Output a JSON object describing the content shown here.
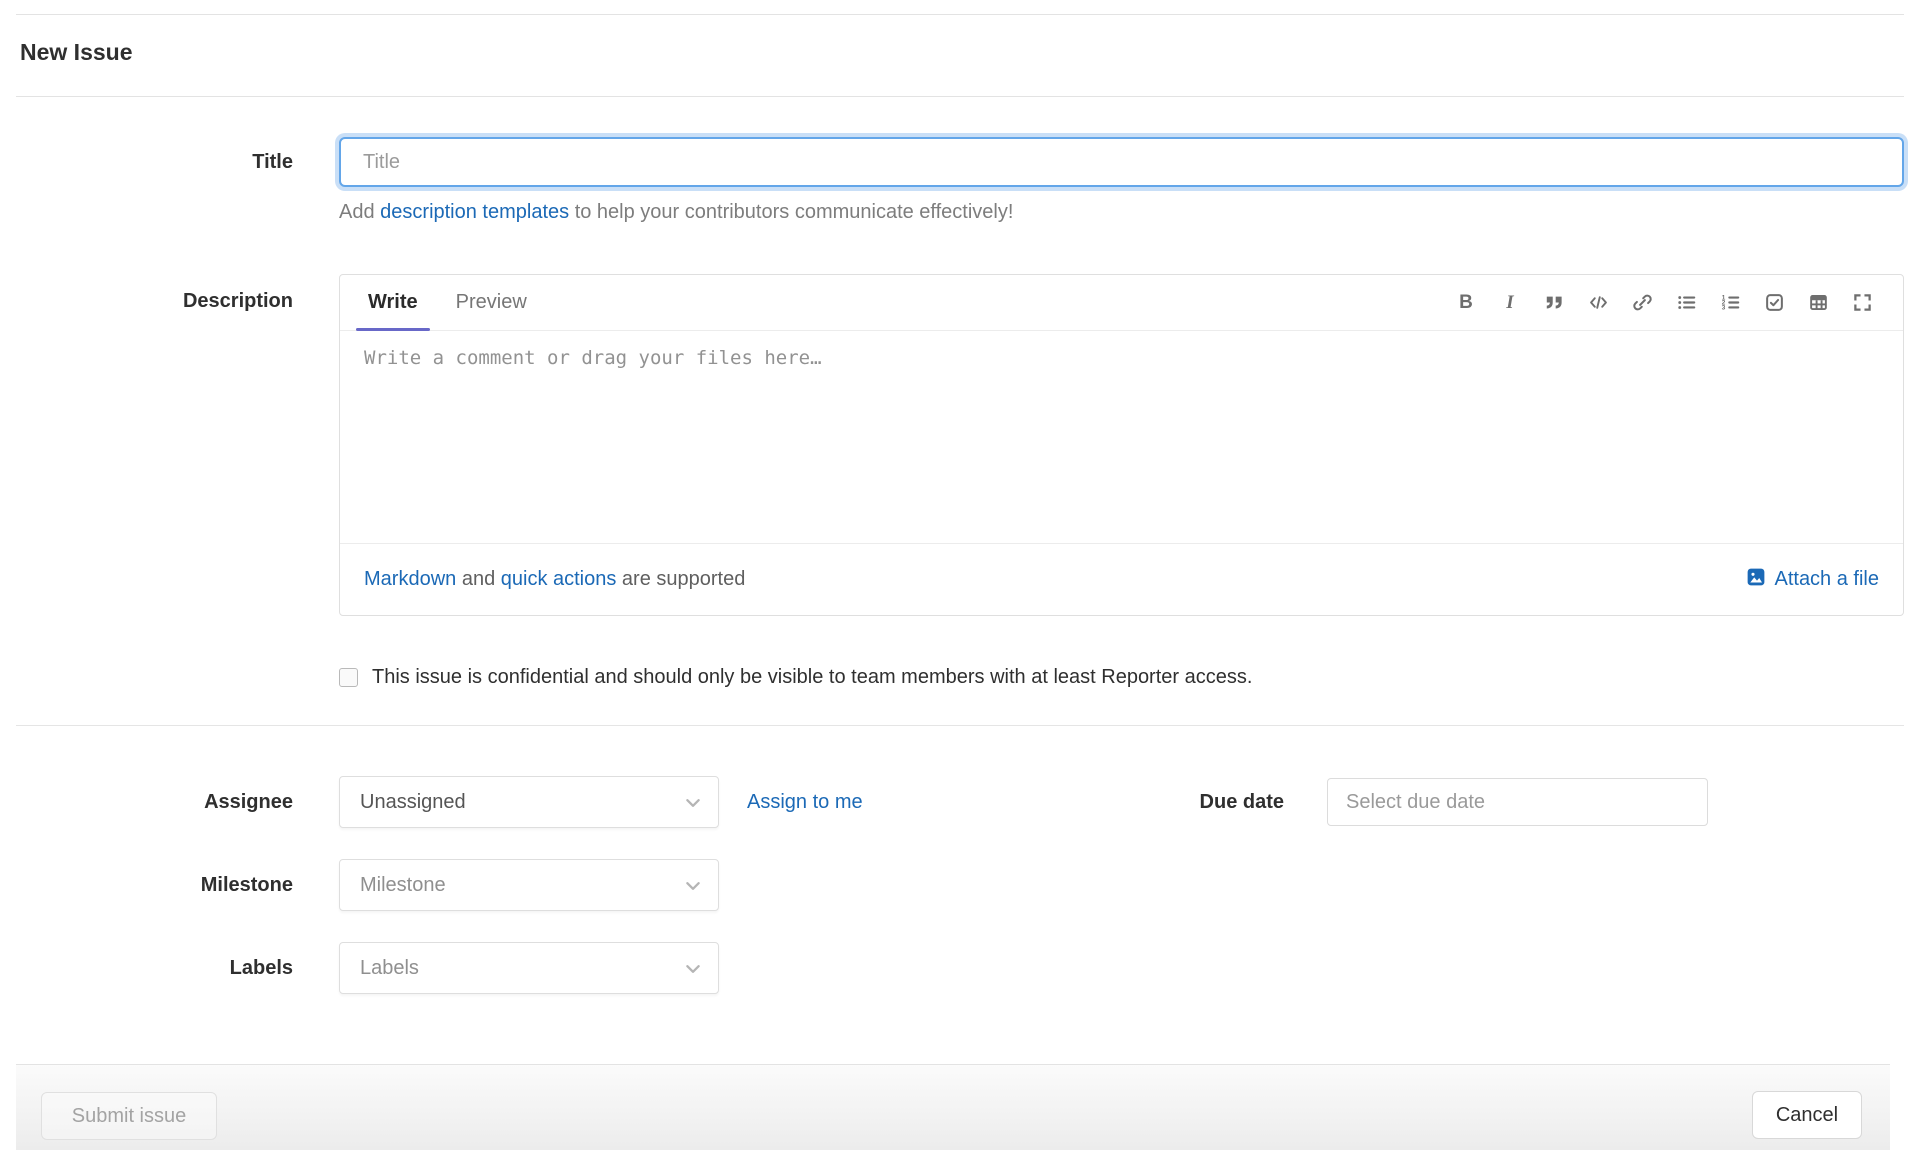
{
  "page": {
    "title": "New Issue"
  },
  "title_field": {
    "label": "Title",
    "placeholder": "Title",
    "help": {
      "prefix": "Add ",
      "link": "description templates",
      "suffix": " to help your contributors communicate effectively!"
    }
  },
  "description": {
    "label": "Description",
    "tabs": {
      "write": "Write",
      "preview": "Preview"
    },
    "toolbar_icons": [
      "bold",
      "italic",
      "quote",
      "code",
      "link",
      "bulleted-list",
      "numbered-list",
      "task-list",
      "table",
      "full-screen"
    ],
    "toolbar_glyphs": {
      "bold": "B",
      "italic": "I",
      "code": "</>"
    },
    "textarea_placeholder": "Write a comment or drag your files here…",
    "footer": {
      "markdown_link": "Markdown",
      "middle": " and ",
      "quick_actions_link": "quick actions",
      "suffix": " are supported",
      "attach_label": "Attach a file"
    }
  },
  "confidential": {
    "label": "This issue is confidential and should only be visible to team members with at least Reporter access.",
    "checked": false
  },
  "meta": {
    "assignee": {
      "label": "Assignee",
      "value": "Unassigned",
      "assign_to_me": "Assign to me"
    },
    "due_date": {
      "label": "Due date",
      "placeholder": "Select due date"
    },
    "milestone": {
      "label": "Milestone",
      "placeholder": "Milestone"
    },
    "labels": {
      "label": "Labels",
      "placeholder": "Labels"
    }
  },
  "actions": {
    "submit": "Submit issue",
    "cancel": "Cancel"
  },
  "colors": {
    "link_blue": "#1b69b6",
    "tab_accent": "#6868c8",
    "focus_border": "#63a6e9",
    "focus_glow": "#c9dff7"
  }
}
